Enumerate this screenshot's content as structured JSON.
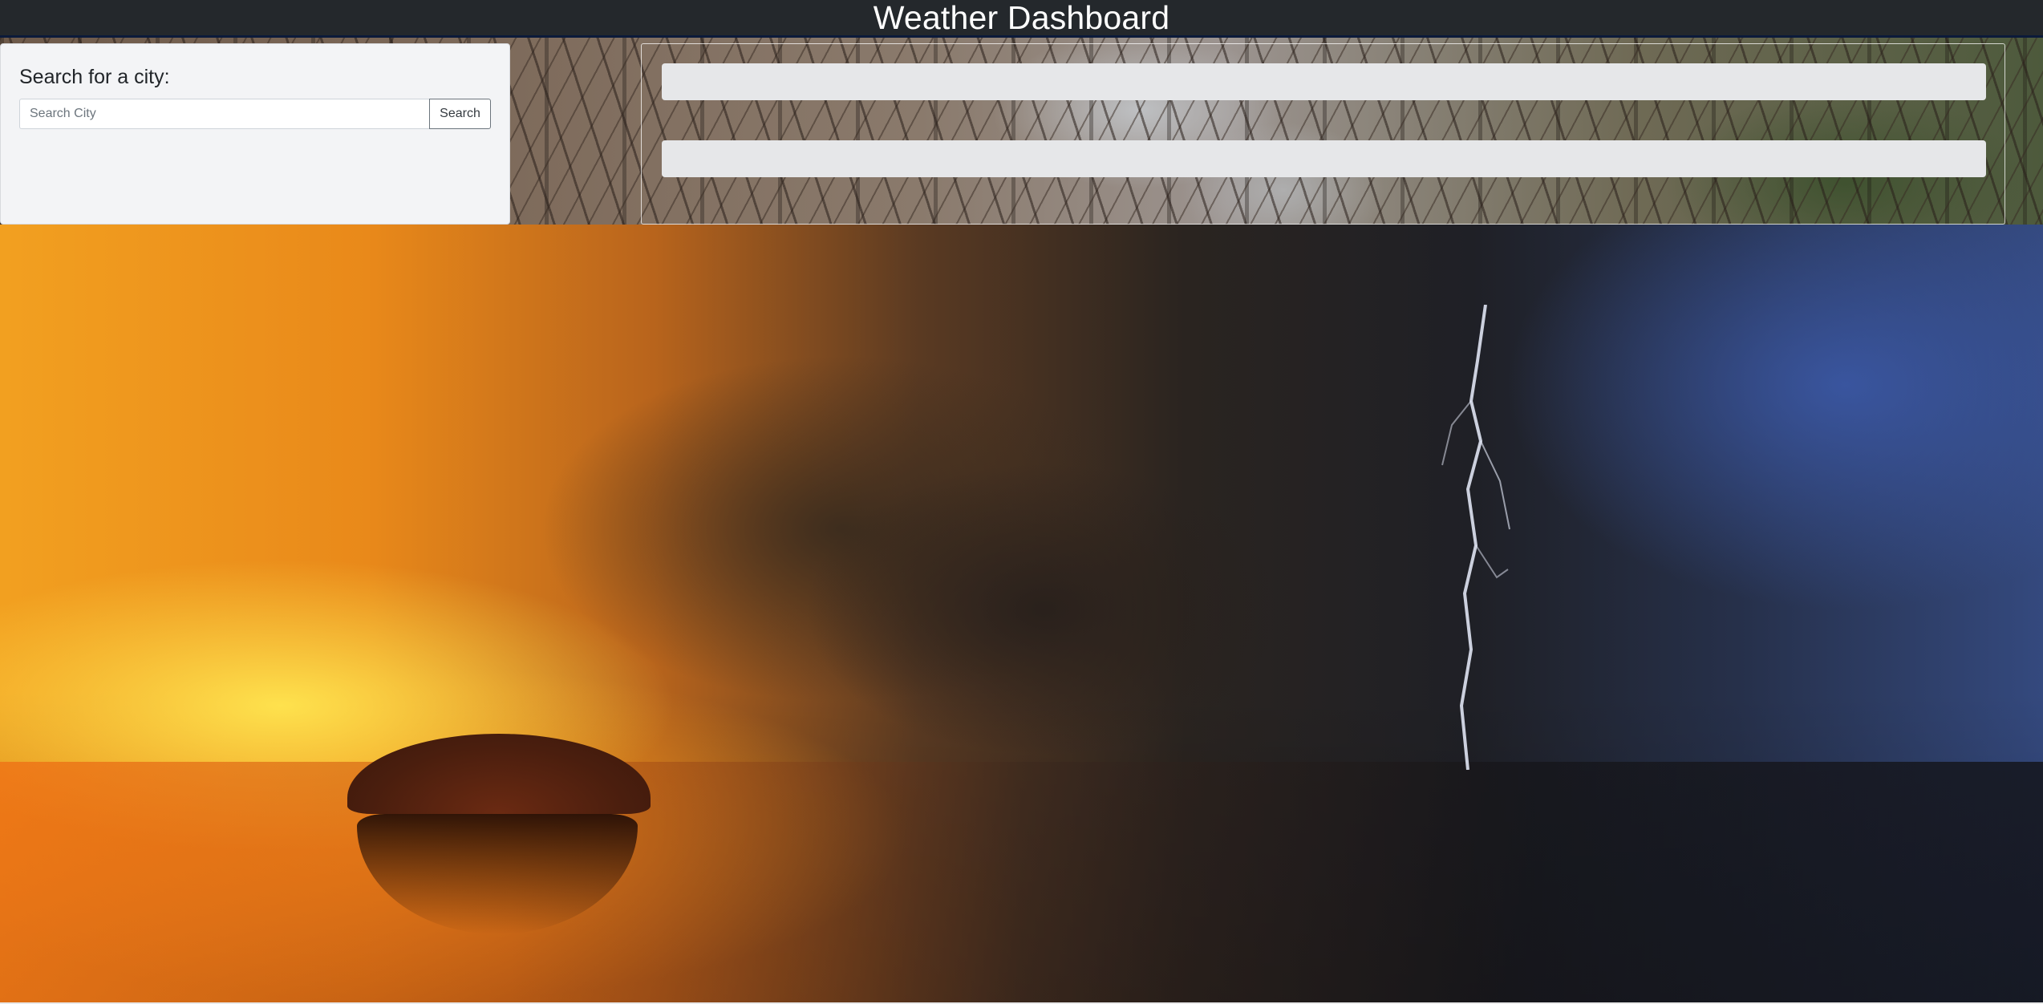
{
  "header": {
    "title": "Weather Dashboard"
  },
  "search": {
    "label": "Search for a city:",
    "placeholder": "Search City",
    "value": "",
    "button_label": "Search"
  },
  "results": {
    "current_weather_text": "",
    "forecast_text": ""
  },
  "colors": {
    "header_bg": "#24282c",
    "panel_bg": "#f3f4f6",
    "result_bar_bg": "#e6e7e9"
  }
}
